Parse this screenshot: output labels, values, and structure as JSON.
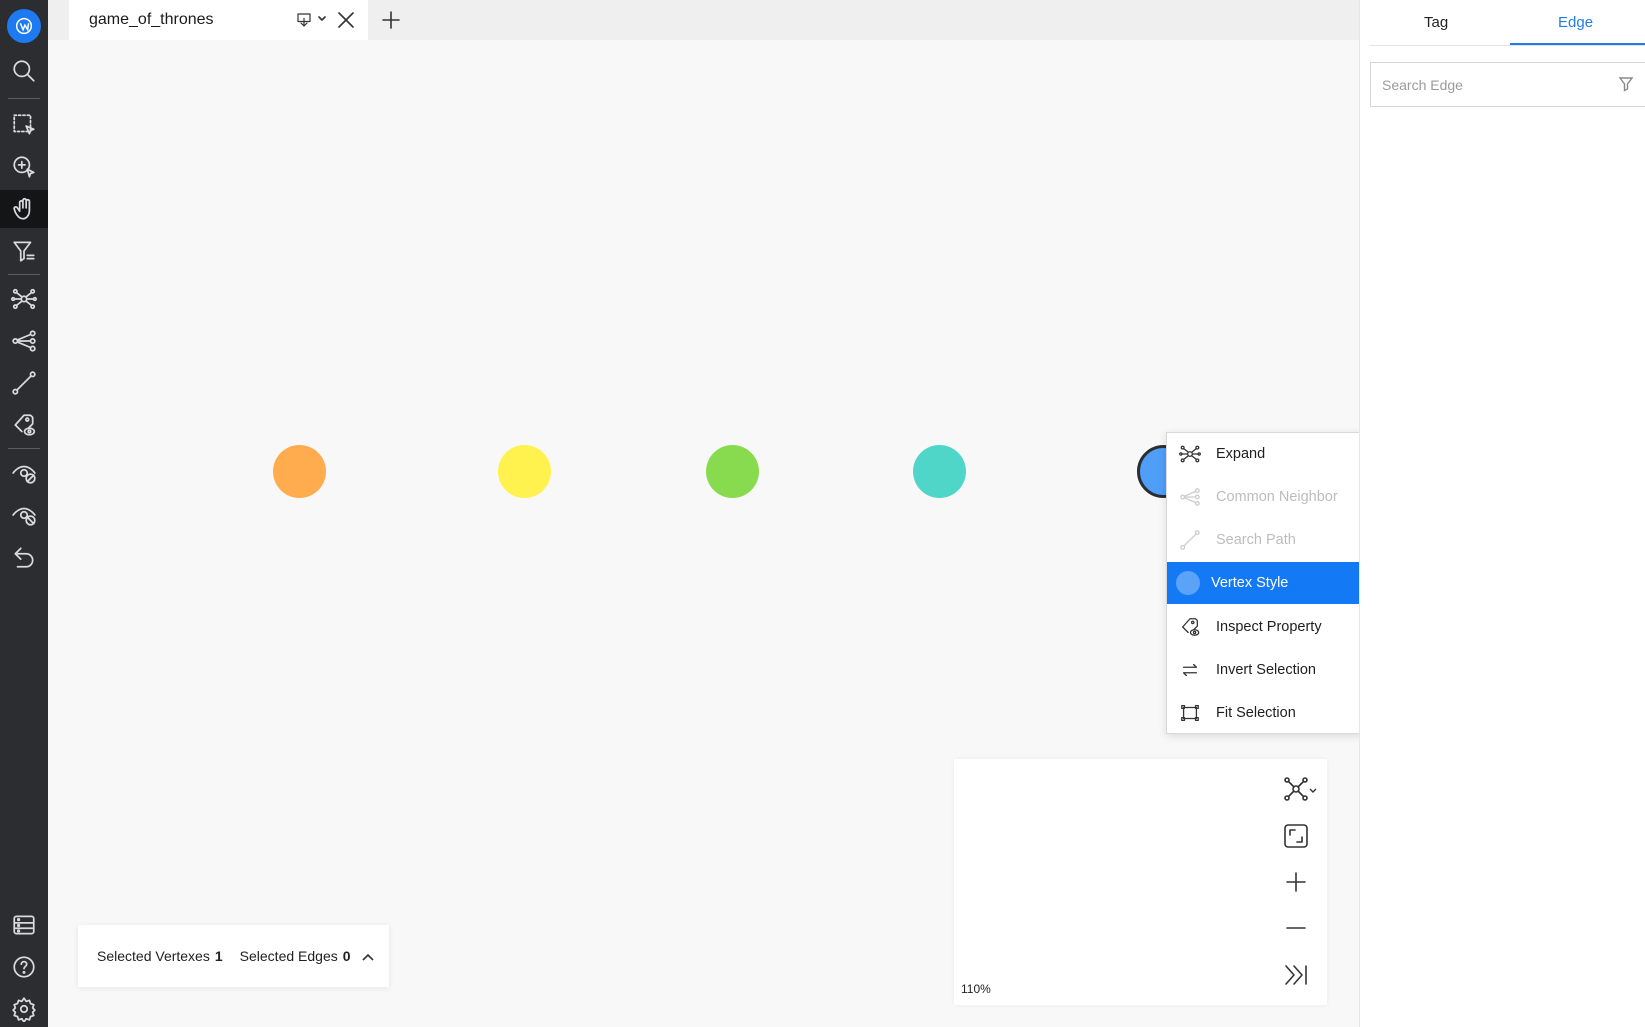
{
  "tab": {
    "title": "game_of_thrones"
  },
  "right_panel": {
    "tabs": [
      {
        "label": "Tag"
      },
      {
        "label": "Edge"
      }
    ],
    "selected_tab": "Edge",
    "search": {
      "placeholder": "Search Edge",
      "value": ""
    }
  },
  "vertices": [
    {
      "color": "#ffac4f",
      "border": "none"
    },
    {
      "color": "#fff24f",
      "border": "none"
    },
    {
      "color": "#88db4f",
      "border": "none"
    },
    {
      "color": "#4fd6c8",
      "border": "none"
    },
    {
      "color": "#4f9ef8",
      "border": "#2b2d31",
      "selected": true
    }
  ],
  "context_menu": {
    "items": [
      {
        "label": "Expand",
        "icon": "expand-icon",
        "disabled": false
      },
      {
        "label": "Common Neighbor",
        "icon": "common-neighbor-icon",
        "disabled": true
      },
      {
        "label": "Search Path",
        "icon": "search-path-icon",
        "disabled": true
      },
      {
        "label": "Vertex Style",
        "icon": "vertex-style-dot",
        "highlighted": true
      },
      {
        "label": "Inspect Property",
        "icon": "inspect-property-icon",
        "disabled": false
      },
      {
        "label": "Invert Selection",
        "icon": "invert-selection-icon",
        "disabled": false
      },
      {
        "label": "Fit Selection",
        "icon": "fit-selection-icon",
        "disabled": false
      }
    ]
  },
  "zoom_panel": {
    "zoom_level": "110%"
  },
  "selection_status": {
    "vertexes_label": "Selected Vertexes",
    "vertexes_count": "1",
    "edges_label": "Selected Edges",
    "edges_count": "0"
  },
  "colors": {
    "accent": "#1f7de8",
    "sidebar_bg": "#2b2d31",
    "menu_highlight": "#1379f5"
  },
  "left_toolbar_icons": [
    "logo-icon",
    "search-icon",
    "box-select-icon",
    "lasso-select-icon",
    "hand-pan-icon",
    "filter-icon",
    "expand-icon",
    "common-neighbor-icon",
    "path-icon",
    "inspect-property-icon",
    "hide-vertex-icon",
    "hide-other-icon",
    "undo-icon",
    "console-icon",
    "help-icon",
    "settings-icon"
  ]
}
